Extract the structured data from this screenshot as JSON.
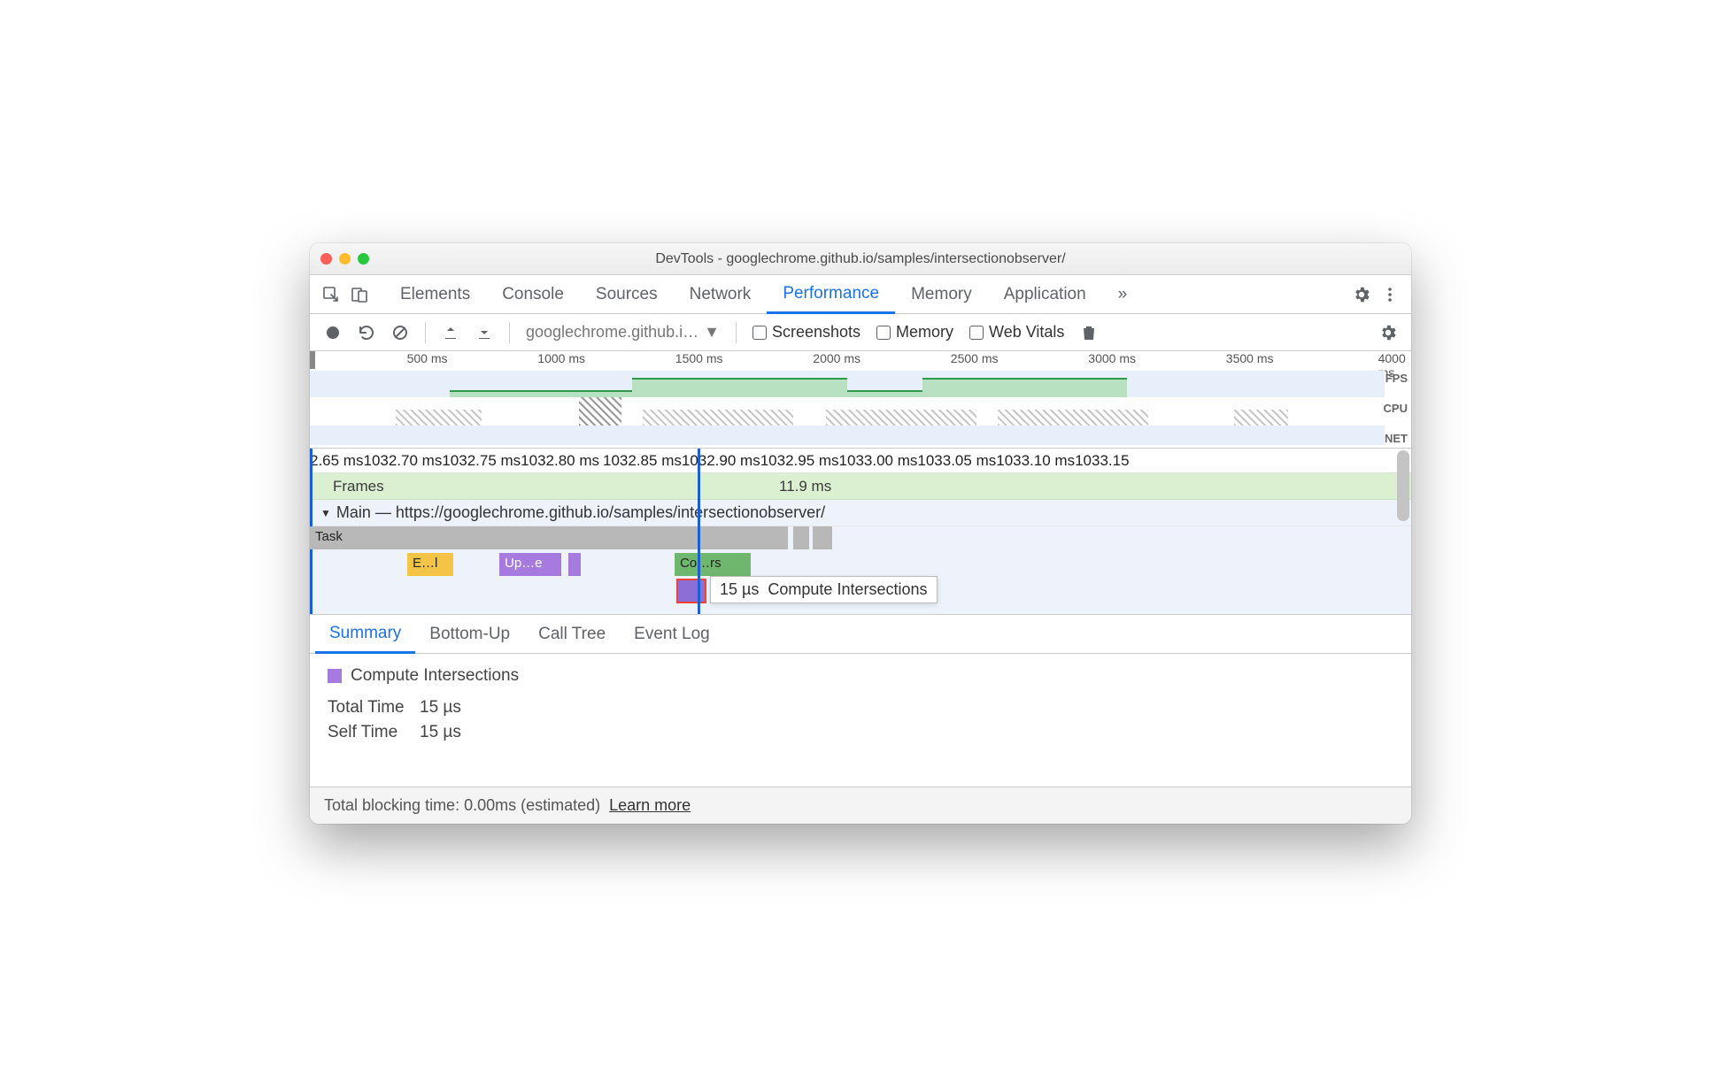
{
  "window": {
    "title": "DevTools - googlechrome.github.io/samples/intersectionobserver/"
  },
  "tabs": {
    "items": [
      "Elements",
      "Console",
      "Sources",
      "Network",
      "Performance",
      "Memory",
      "Application"
    ],
    "active": "Performance",
    "overflow": "»"
  },
  "toolbar": {
    "recording_label": "googlechrome.github.i…",
    "screenshots": "Screenshots",
    "memory": "Memory",
    "web_vitals": "Web Vitals"
  },
  "overview": {
    "ticks": [
      "500 ms",
      "1000 ms",
      "1500 ms",
      "2000 ms",
      "2500 ms",
      "3000 ms",
      "3500 ms",
      "4000 ms"
    ],
    "lanes": {
      "fps": "FPS",
      "cpu": "CPU",
      "net": "NET"
    }
  },
  "detail": {
    "ruler_ticks": [
      "2.65 ms",
      "1032.70 ms",
      "1032.75 ms",
      "1032.80 ms",
      "1032.85 ms",
      "1032.90 ms",
      "1032.95 ms",
      "1033.00 ms",
      "1033.05 ms",
      "1033.10 ms",
      "1033.15"
    ],
    "frames_label": "Frames",
    "frames_time": "11.9 ms",
    "main_label": "Main — https://googlechrome.github.io/samples/intersectionobserver/",
    "events": {
      "task": "Task",
      "e": "E…l",
      "u": "Up…e",
      "c": "Co…rs"
    },
    "tooltip": {
      "duration": "15 µs",
      "name": "Compute Intersections"
    }
  },
  "bottom_tabs": {
    "items": [
      "Summary",
      "Bottom-Up",
      "Call Tree",
      "Event Log"
    ],
    "active": "Summary"
  },
  "summary": {
    "event_name": "Compute Intersections",
    "total_time_label": "Total Time",
    "total_time_value": "15 µs",
    "self_time_label": "Self Time",
    "self_time_value": "15 µs"
  },
  "footer": {
    "text": "Total blocking time: 0.00ms (estimated)",
    "link": "Learn more"
  }
}
